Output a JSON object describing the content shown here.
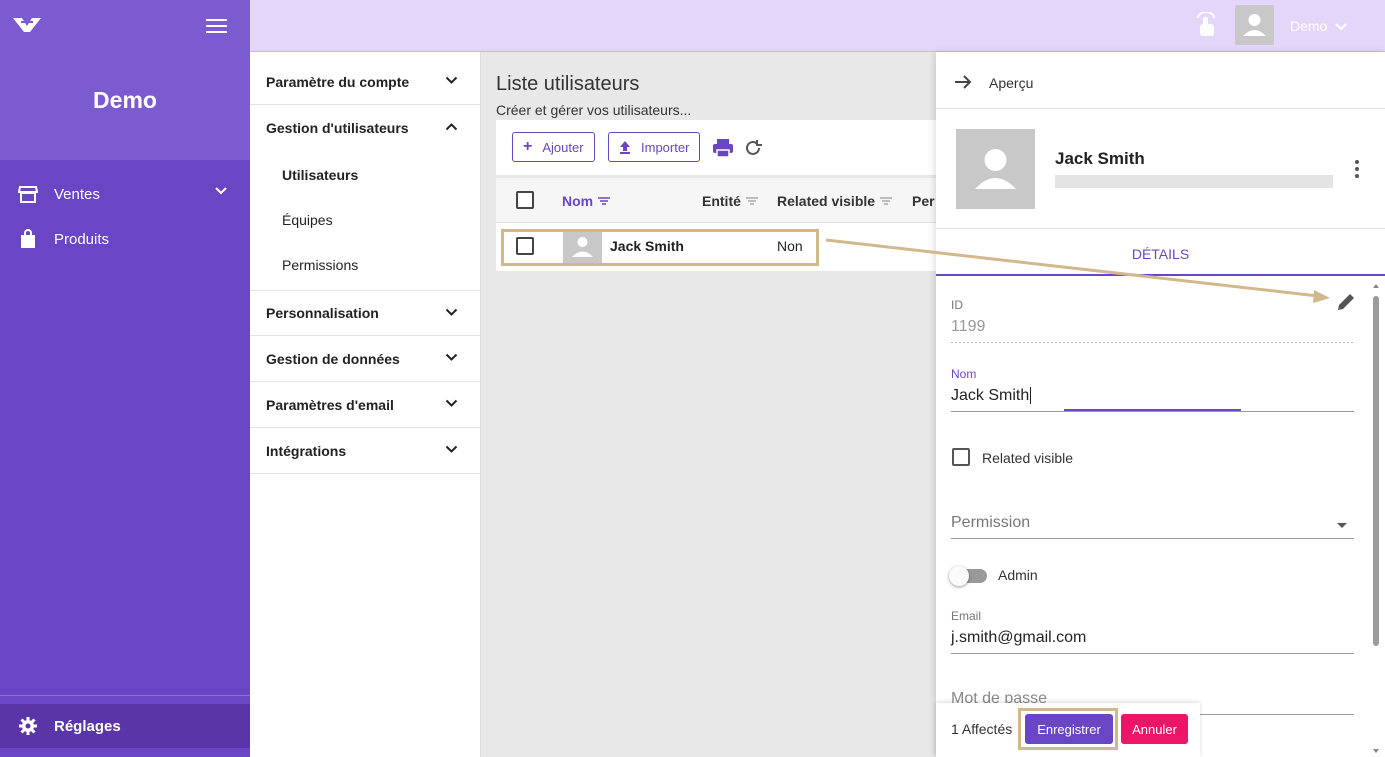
{
  "sidebar": {
    "brand": "Demo",
    "items": [
      {
        "label": "Ventes"
      },
      {
        "label": "Produits"
      }
    ],
    "settings_label": "Réglages"
  },
  "topbar": {
    "user_name": "Demo"
  },
  "settings_menu": {
    "sections": [
      {
        "label": "Paramètre du compte"
      },
      {
        "label": "Gestion d'utilisateurs"
      },
      {
        "label": "Personnalisation"
      },
      {
        "label": "Gestion de données"
      },
      {
        "label": "Paramètres d'email"
      },
      {
        "label": "Intégrations"
      }
    ],
    "sub_items": [
      {
        "label": "Utilisateurs"
      },
      {
        "label": "Équipes"
      },
      {
        "label": "Permissions"
      }
    ]
  },
  "main": {
    "title": "Liste utilisateurs",
    "subtitle": "Créer et gérer vos utilisateurs...",
    "toolbar": {
      "add_label": "Ajouter",
      "import_label": "Importer"
    },
    "table": {
      "columns": [
        "Nom",
        "Entité",
        "Related visible",
        "Per"
      ],
      "rows": [
        {
          "name": "Jack Smith",
          "entite": "",
          "related_visible": "Non"
        }
      ]
    }
  },
  "panel": {
    "header_label": "Aperçu",
    "user_name": "Jack Smith",
    "tab_label": "DÉTAILS",
    "fields": {
      "id_label": "ID",
      "id_value": "1199",
      "nom_label": "Nom",
      "nom_value": "Jack Smith",
      "related_visible_label": "Related visible",
      "permission_label": "Permission",
      "admin_label": "Admin",
      "email_label": "Email",
      "email_value": "j.smith@gmail.com",
      "password_label": "Mot de passe"
    },
    "footer": {
      "affected": "1 Affectés",
      "save_label": "Enregistrer",
      "cancel_label": "Annuler"
    }
  },
  "colors": {
    "brand": "#6a45c4",
    "topbar": "#e4d5fb",
    "cancel": "#ec1568",
    "highlight": "#d2b98c"
  }
}
